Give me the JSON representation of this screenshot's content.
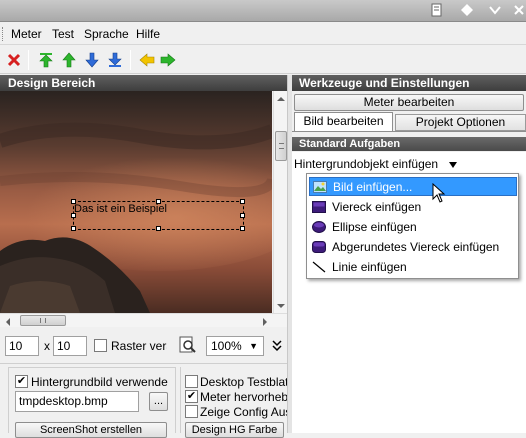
{
  "menu": {
    "items": [
      "Meter",
      "Test",
      "Sprache",
      "Hilfe"
    ]
  },
  "toolbar": {
    "icons": [
      "delete-icon",
      "move-top-icon",
      "move-up-icon",
      "move-down-icon",
      "move-bottom-icon",
      "arrow-left-icon",
      "arrow-right-icon"
    ]
  },
  "left_panel": {
    "title": "Design Bereich",
    "canvas": {
      "sample_text": "Das ist ein Beispiel"
    },
    "controls": {
      "grid_x": "10",
      "x_sep": "x",
      "grid_y": "10",
      "raster_label": "Raster vera",
      "zoom": "100%"
    }
  },
  "bottom_left": {
    "bg_checkbox_label": "Hintergrundbild verwende",
    "bg_checkbox_checked": true,
    "bg_file": "tmpdesktop.bmp",
    "browse_label": "...",
    "screenshot_button": "ScreenShot erstellen"
  },
  "bottom_right": {
    "desktop_test_label": "Desktop Testblatt",
    "desktop_test_checked": false,
    "highlight_label": "Meter hervorhebe",
    "highlight_checked": true,
    "show_config_label": "Zeige Config Aus",
    "show_config_checked": false,
    "design_hg_button": "Design HG Farbe"
  },
  "right_panel": {
    "title": "Werkzeuge und Einstellungen",
    "edit_meter_button": "Meter bearbeiten",
    "tabs": [
      "Bild bearbeiten",
      "Projekt Optionen"
    ],
    "standard_tasks_header": "Standard Aufgaben",
    "action_label": "Hintergrundobjekt einfügen",
    "menu_items": [
      "Bild einfügen...",
      "Viereck einfügen",
      "Ellipse einfügen",
      "Abgerundetes Viereck einfügen",
      "Linie einfügen"
    ]
  },
  "colors": {
    "selection": "#3399ff",
    "header_dark": "#4a4a4a",
    "toolbar_green": "#2db52d",
    "toolbar_blue": "#2f6bd8",
    "toolbar_yellow": "#f2c400",
    "delete_red": "#d62020"
  }
}
